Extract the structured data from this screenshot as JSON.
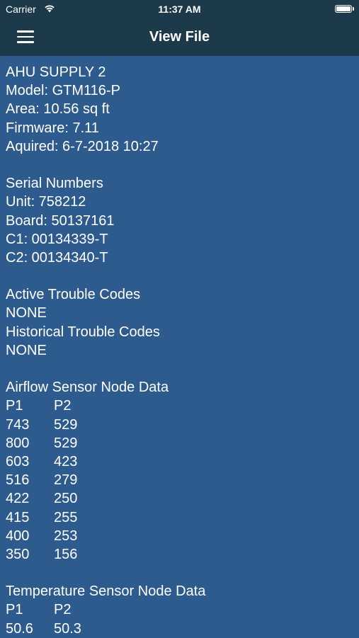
{
  "status_bar": {
    "carrier": "Carrier",
    "time": "11:37 AM"
  },
  "nav": {
    "title": "View File"
  },
  "device": {
    "name": "AHU SUPPLY 2",
    "model": "Model: GTM116-P",
    "area": "Area: 10.56 sq ft",
    "firmware": "Firmware: 7.11",
    "acquired": "Aquired: 6-7-2018 10:27"
  },
  "serials": {
    "heading": "Serial Numbers",
    "unit": "Unit: 758212",
    "board": "Board: 50137161",
    "c1": "C1: 00134339-T",
    "c2": "C2: 00134340-T"
  },
  "trouble_codes": {
    "active_heading": "Active Trouble Codes",
    "active_value": "NONE",
    "historical_heading": "Historical Trouble Codes",
    "historical_value": "NONE"
  },
  "airflow": {
    "heading": "Airflow Sensor Node Data",
    "columns": [
      "P1",
      "P2"
    ],
    "rows": [
      [
        "743",
        "529"
      ],
      [
        "800",
        "529"
      ],
      [
        "603",
        "423"
      ],
      [
        "516",
        "279"
      ],
      [
        "422",
        "250"
      ],
      [
        "415",
        "255"
      ],
      [
        "400",
        "253"
      ],
      [
        "350",
        "156"
      ]
    ]
  },
  "temperature": {
    "heading": "Temperature Sensor Node Data",
    "columns": [
      "P1",
      "P2"
    ],
    "rows": [
      [
        "50.6",
        "50.3"
      ]
    ]
  },
  "colors": {
    "background": "#2e5b8d",
    "bar": "#1d3a4a",
    "text": "#ffffff"
  }
}
